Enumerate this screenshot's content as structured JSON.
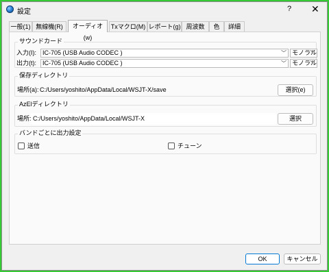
{
  "window": {
    "title": "設定",
    "help": "?",
    "close": "✕"
  },
  "tabs": [
    {
      "label": "一般(1)"
    },
    {
      "label": "無線機(R)"
    },
    {
      "label": "オーディオ(w)"
    },
    {
      "label": "Txマクロ(M)"
    },
    {
      "label": "レポート(g)"
    },
    {
      "label": "周波数"
    },
    {
      "label": "色"
    },
    {
      "label": "詳細"
    }
  ],
  "soundcard": {
    "title": "サウンドカード",
    "input_label": "入力(I):",
    "input_device": "IC-705 (USB Audio CODEC )",
    "input_channel": "モノラル",
    "output_label": "出力(t):",
    "output_device": "IC-705 (USB Audio CODEC )",
    "output_channel": "モノラル"
  },
  "save_dir": {
    "title": "保存ディレクトリ",
    "location_label": "場所(a):",
    "path": "C:/Users/yoshito/AppData/Local/WSJT-X/save",
    "button": "選択(e)"
  },
  "azel_dir": {
    "title": "AzElディレクトリ",
    "location_label": "場所:",
    "path": "C:/Users/yoshito/AppData/Local/WSJT-X",
    "button": "選択"
  },
  "band_output": {
    "title": "バンドごとに出力設定",
    "tx_label": "送信",
    "tune_label": "チューン"
  },
  "footer": {
    "ok": "OK",
    "cancel": "キャンセル"
  },
  "colors": {
    "background": "#36c936",
    "accent": "#0078d4"
  }
}
